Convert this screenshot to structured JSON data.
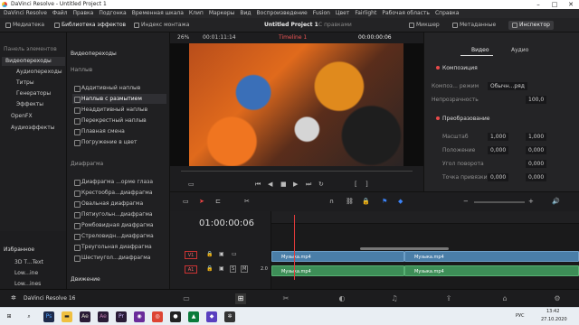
{
  "window": {
    "title": "DaVinci Resolve - Untitled Project 1"
  },
  "menu": [
    "DaVinci Resolve",
    "Файл",
    "Правка",
    "Подгонка",
    "Временная шкала",
    "Клип",
    "Маркеры",
    "Вид",
    "Воспроизведение",
    "Fusion",
    "Цвет",
    "Fairlight",
    "Рабочая область",
    "Справка"
  ],
  "toolbar": {
    "media": "Медиатека",
    "effects": "Библиотека эффектов",
    "index": "Индекс монтажа",
    "project": "Untitled Project 1",
    "history": "С правками",
    "mixer": "Микшер",
    "metadata": "Метаданные",
    "inspector": "Инспектор"
  },
  "left_panel": {
    "header": "Панель элементов",
    "items": [
      "Видеопереходы",
      "Аудиопереходы",
      "Титры",
      "Генераторы",
      "Эффекты",
      "OpenFX",
      "Аудиоэффекты"
    ],
    "favorites": "Избранное",
    "fav_items": [
      "3D Т...Text",
      "Low...ine",
      "Low...ines"
    ]
  },
  "effects": {
    "title": "Видеопереходы",
    "sec1": "Наплыв",
    "dissolve": [
      "Аддитивный наплыв",
      "Наплыв с размытием",
      "Неаддитивный наплыв",
      "Перекрестный наплыв",
      "Плавная смена",
      "Погружение в цвет"
    ],
    "sec2": "Диафрагма",
    "iris": [
      "Диафрагма ...орме глаза",
      "Крестообра...диафрагма",
      "Овальная диафрагма",
      "Пятиугольн...диафрагма",
      "Ромбовидная диафрагма",
      "Стреловидн...диафрагма",
      "Треугольная диафрагма",
      "Шестиугол...диафрагма"
    ],
    "sec3": "Движение"
  },
  "viewer": {
    "zoom": "26%",
    "source_tc": "00:01:11:14",
    "timeline_name": "Timeline 1",
    "tc": "00:00:00:06"
  },
  "inspector": {
    "tab_video": "Видео",
    "tab_audio": "Аудио",
    "composition": "Композиция",
    "comp_mode_label": "Композ... режим",
    "comp_mode_value": "Обычн...ряд",
    "opacity_label": "Непрозрачность",
    "opacity_value": "100,0",
    "transform": "Преобразование",
    "zoom_label": "Масштаб",
    "zoom_x": "1,000",
    "zoom_y": "1,000",
    "pos_label": "Положение",
    "pos_x": "0,000",
    "pos_y": "0,000",
    "rot_label": "Угол поворота",
    "rot_value": "0,000",
    "anchor_label": "Точка привязки",
    "anchor_x": "0,000",
    "anchor_y": "0,000"
  },
  "timeline": {
    "tc": "01:00:00:06",
    "v1": "V1",
    "a1": "A1",
    "a1_level": "2.0",
    "clip_v1": "Музыка.mp4",
    "clip_v2": "Музыка.mp4",
    "clip_a1": "Музыка.mp4",
    "clip_a2": "Музыка.mp4"
  },
  "bottom": {
    "app": "DaVinci Resolve 16"
  },
  "taskbar": {
    "lang": "РУС",
    "time": "13:42",
    "date": "27.10.2020"
  }
}
